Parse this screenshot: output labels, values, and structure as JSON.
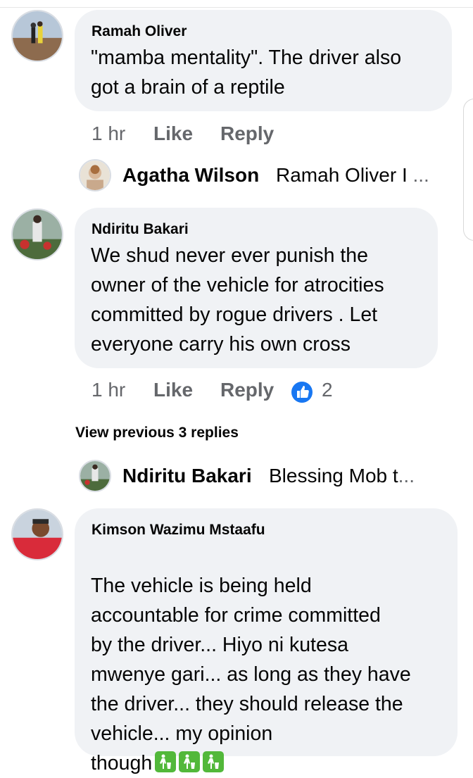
{
  "comments": [
    {
      "author": "Ramah Oliver",
      "text": "\"mamba mentality\". The driver also\ngot a brain of a reptile",
      "time": "1 hr",
      "like_label": "Like",
      "reply_label": "Reply",
      "reply_preview": {
        "author": "Agatha Wilson",
        "snippet": "Ramah Oliver I",
        "ellipsis": "..."
      }
    },
    {
      "author": "Ndiritu Bakari",
      "text": "We shud never ever punish the\nowner of the vehicle for atrocities\ncommitted by rogue drivers . Let\neveryone carry his own cross",
      "time": "1 hr",
      "like_label": "Like",
      "reply_label": "Reply",
      "reaction_count": "2",
      "view_previous": "View previous 3 replies",
      "reply_preview": {
        "author": "Ndiritu Bakari",
        "snippet": "Blessing Mob t",
        "ellipsis": "..."
      }
    },
    {
      "author": "Kimson Wazimu Mstaafu",
      "text": "The vehicle is being held\naccountable for crime committed\nby the driver... Hiyo ni kutesa\nmwenye gari... as long as they have\nthe driver... they should release the\nvehicle... my opinion\nthough",
      "emoji": [
        "put-litter-in-its-place-icon",
        "put-litter-in-its-place-icon",
        "put-litter-in-its-place-icon"
      ]
    }
  ],
  "colors": {
    "bubble": "#f0f2f5",
    "meta": "#65676b",
    "like_blue": "#1877f2",
    "emoji_green": "#52b83a"
  }
}
